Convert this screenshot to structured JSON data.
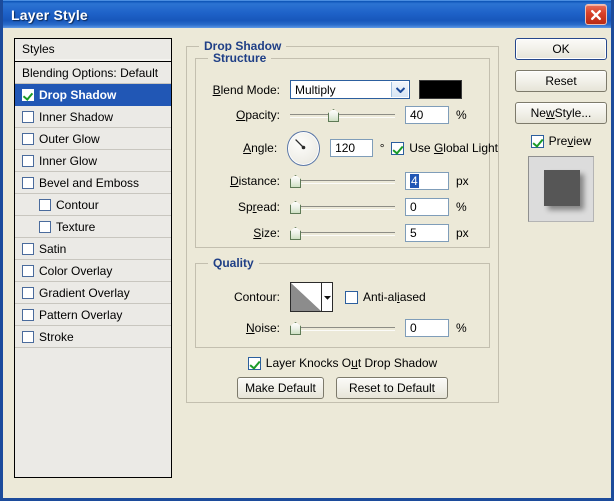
{
  "window": {
    "title": "Layer Style",
    "close_icon": "close-icon",
    "title_bar_color": "#1e62c8",
    "frame_color": "#1c4b9b",
    "face_color": "#ece9d8"
  },
  "styles_panel": {
    "header": "Styles",
    "items": [
      {
        "label": "Blending Options: Default",
        "checkbox": false,
        "has_checkbox": false,
        "indent": false,
        "selected": false
      },
      {
        "label": "Drop Shadow",
        "checkbox": true,
        "has_checkbox": true,
        "indent": false,
        "selected": true
      },
      {
        "label": "Inner Shadow",
        "checkbox": false,
        "has_checkbox": true,
        "indent": false,
        "selected": false
      },
      {
        "label": "Outer Glow",
        "checkbox": false,
        "has_checkbox": true,
        "indent": false,
        "selected": false
      },
      {
        "label": "Inner Glow",
        "checkbox": false,
        "has_checkbox": true,
        "indent": false,
        "selected": false
      },
      {
        "label": "Bevel and Emboss",
        "checkbox": false,
        "has_checkbox": true,
        "indent": false,
        "selected": false
      },
      {
        "label": "Contour",
        "checkbox": false,
        "has_checkbox": true,
        "indent": true,
        "selected": false
      },
      {
        "label": "Texture",
        "checkbox": false,
        "has_checkbox": true,
        "indent": true,
        "selected": false
      },
      {
        "label": "Satin",
        "checkbox": false,
        "has_checkbox": true,
        "indent": false,
        "selected": false
      },
      {
        "label": "Color Overlay",
        "checkbox": false,
        "has_checkbox": true,
        "indent": false,
        "selected": false
      },
      {
        "label": "Gradient Overlay",
        "checkbox": false,
        "has_checkbox": true,
        "indent": false,
        "selected": false
      },
      {
        "label": "Pattern Overlay",
        "checkbox": false,
        "has_checkbox": true,
        "indent": false,
        "selected": false
      },
      {
        "label": "Stroke",
        "checkbox": false,
        "has_checkbox": true,
        "indent": false,
        "selected": false
      }
    ],
    "selected_index": 1
  },
  "drop_shadow": {
    "group_title": "Drop Shadow",
    "structure": {
      "group_title": "Structure",
      "blend_mode_label": "Blend Mode:",
      "blend_mode_value": "Multiply",
      "blend_mode_arrow": "chevron-down-icon",
      "color_swatch": "#000000",
      "opacity_label": "Opacity:",
      "opacity_value": "40",
      "opacity_unit": "%",
      "opacity_percent": 40,
      "angle_label": "Angle:",
      "angle_value": "120",
      "angle_unit": "°",
      "angle_degrees": 120,
      "use_global_light_label": "Use Global Light",
      "use_global_light_checked": true,
      "distance_label": "Distance:",
      "distance_value": "4",
      "distance_unit": "px",
      "distance_percent": 3,
      "spread_label": "Spread:",
      "spread_value": "0",
      "spread_unit": "%",
      "spread_percent": 0,
      "size_label": "Size:",
      "size_value": "5",
      "size_unit": "px",
      "size_percent": 2
    },
    "quality": {
      "group_title": "Quality",
      "contour_label": "Contour:",
      "contour_arrow": "chevron-down-icon",
      "anti_aliased_label": "Anti-aliased",
      "anti_aliased_checked": false,
      "noise_label": "Noise:",
      "noise_value": "0",
      "noise_unit": "%",
      "noise_percent": 0
    },
    "knocks_out_label": "Layer Knocks Out Drop Shadow",
    "knocks_out_checked": true,
    "make_default_button": "Make Default",
    "reset_to_default_button": "Reset to Default"
  },
  "right_panel": {
    "ok_button": "OK",
    "reset_button": "Reset",
    "new_style_button": "New Style...",
    "preview_label": "Preview",
    "preview_checked": true
  }
}
